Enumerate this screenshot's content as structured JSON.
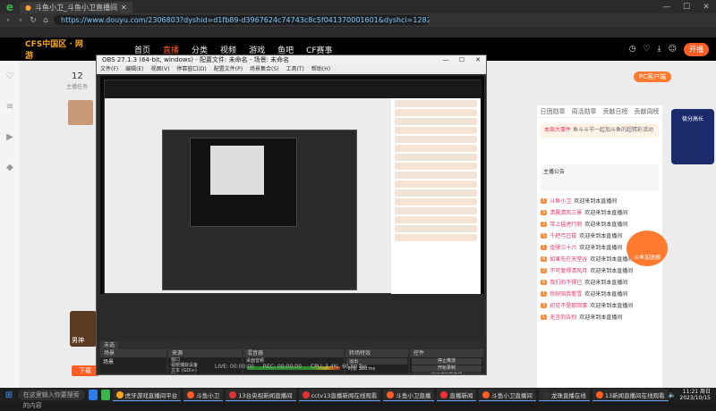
{
  "browser": {
    "tab_title": "斗鱼小卫_斗鱼小卫直播间",
    "url": "https://www.douyu.com/2306803?dyshid=d1fb89-d3967624c74743c8c5f041370001601&dyshci=1282"
  },
  "douyu": {
    "nav": [
      "首页",
      "直播",
      "分类",
      "视频",
      "游戏",
      "鱼吧",
      "CF赛事"
    ],
    "active_nav": "直播",
    "open_live_label": "开播",
    "room_fans_count": "12",
    "room_subtitle": "主播任务",
    "download_label": "下载",
    "streamer_name": "男神",
    "right_tabs": [
      "日团勋章",
      "周活勋章",
      "贡献日榜",
      "贡献周榜"
    ],
    "notice_title": "本周大事件",
    "notice_text": "鱼斗斗节一起加斗鱼的超精彩活动",
    "announcement_label": "主播公告",
    "chat_welcome_suffix": "欢迎来到本直播间",
    "chat_lines": [
      {
        "level": "1",
        "nick": "斗鱼小卫"
      },
      {
        "level": "3",
        "nick": "清晨清风三景"
      },
      {
        "level": "2",
        "nick": "带上猛虎行刺"
      },
      {
        "level": "5",
        "nick": "千把弓已拔"
      },
      {
        "level": "1",
        "nick": "金陵三十六"
      },
      {
        "level": "4",
        "nick": "如果先在天堂谷"
      },
      {
        "level": "2",
        "nick": "不可复得清风月"
      },
      {
        "level": "6",
        "nick": "我们的不得已"
      },
      {
        "level": "1",
        "nick": "你好陪我看雪"
      },
      {
        "level": "3",
        "nick": "初见不是那回事"
      },
      {
        "level": "1",
        "nick": "无言的告别"
      }
    ],
    "pc_client_label": "PC客户端",
    "promo_text": "斗鱼加速器",
    "promo_side": "极分高长"
  },
  "obs": {
    "title": "OBS 27.1.3 (64-bit, windows) - 配置文件: 未命名 - 场景: 未命名",
    "menu": [
      "文件(F)",
      "编辑(E)",
      "视图(V)",
      "停靠窗口(D)",
      "配置文件(P)",
      "场景集合(S)",
      "工具(T)",
      "帮助(H)"
    ],
    "status_text": "未选择源",
    "dock_titles": [
      "场景",
      "来源",
      "混音器",
      "转场特效",
      "控件"
    ],
    "sources": [
      "窗口",
      "视频捕获设备",
      "文本 (GDI+)",
      "图像",
      "显示器采集",
      "文本 (GDI+) 2"
    ],
    "scene": "场景",
    "mixer_tracks": [
      "桌面音频",
      "麦克风/Aux"
    ],
    "transition": "淡出",
    "duration_label": "时长",
    "duration_value": "300 ms",
    "controls": [
      "停止推流",
      "开始录制",
      "启动虚拟摄像机",
      "工作室模式",
      "设置",
      "退出"
    ],
    "stats": [
      "LIVE: 00:00:00",
      "REC: 00:00:00",
      "CPU: 3.4%, 60.00 fps"
    ]
  },
  "taskbar": {
    "search_placeholder": "在这里输入你要搜索的内容",
    "apps": [
      "虎牙游戏直播间平台",
      "斗鱼小卫",
      "13台央视新闻直播间",
      "cctv13直播新闻在线观看",
      "斗鱼小卫直播",
      "直播新闻",
      "斗鱼小卫直播间",
      "龙珠直播在线",
      "13新闻直播间在线观看"
    ],
    "time": "11:21 周日",
    "date": "2023/10/15"
  },
  "colors": {
    "accent": "#ff5d23",
    "obs_bg": "#2b2b2b",
    "brand_green": "#3bb54a"
  }
}
